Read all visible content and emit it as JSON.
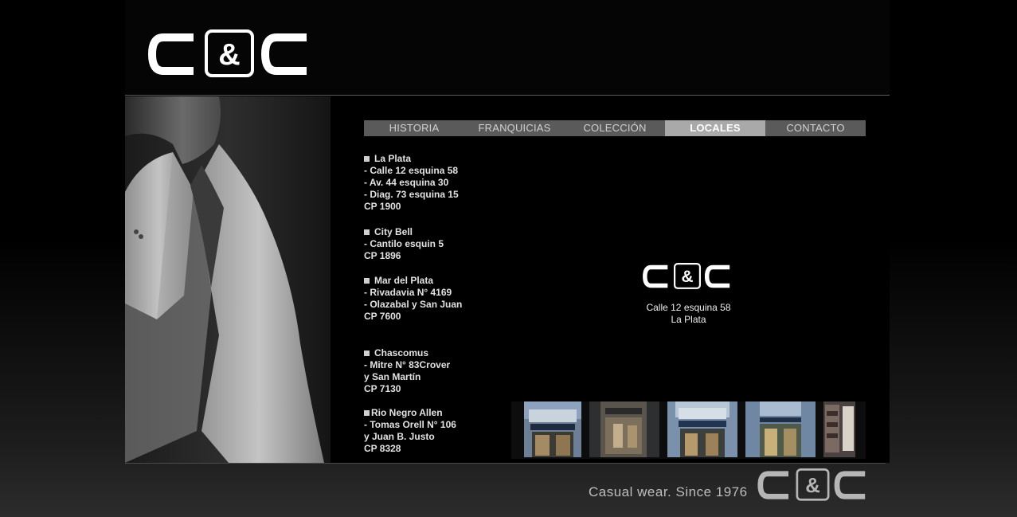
{
  "brand": {
    "logo_text": "C&C",
    "tagline": "Casual wear. Since 1976"
  },
  "nav": [
    {
      "label": "HISTORIA",
      "active": false
    },
    {
      "label": "FRANQUICIAS",
      "active": false
    },
    {
      "label": "COLECCIÓN",
      "active": false
    },
    {
      "label": "LOCALES",
      "active": true
    },
    {
      "label": "CONTACTO",
      "active": false
    }
  ],
  "locations": [
    {
      "city": "La Plata",
      "lines": [
        "- Calle 12 esquina 58",
        "- Av. 44 esquina 30",
        "- Diag. 73 esquina 15",
        "CP 1900"
      ]
    },
    {
      "city": "City Bell",
      "lines": [
        "- Cantilo esquin 5",
        "CP 1896"
      ]
    },
    {
      "city": "Mar del Plata",
      "lines": [
        "- Rivadavia N° 4169",
        "- Olazabal y San Juan",
        "CP 7600"
      ]
    },
    {
      "city": "Chascomus",
      "lines": [
        "- Mitre N° 83Crover",
        "y San Martín",
        "CP 7130"
      ]
    },
    {
      "city": "Rio Negro Allen",
      "lines": [
        "- Tomas Orell N° 106",
        "y Juan B. Justo",
        "CP 8328"
      ]
    }
  ],
  "viewer": {
    "caption_line1": "Calle 12 esquina 58",
    "caption_line2": "La Plata"
  },
  "colors": {
    "background": "#000000",
    "nav_bar": "#5a5a5a",
    "nav_active": "#a9a9a9",
    "text": "#e2e2e2"
  }
}
